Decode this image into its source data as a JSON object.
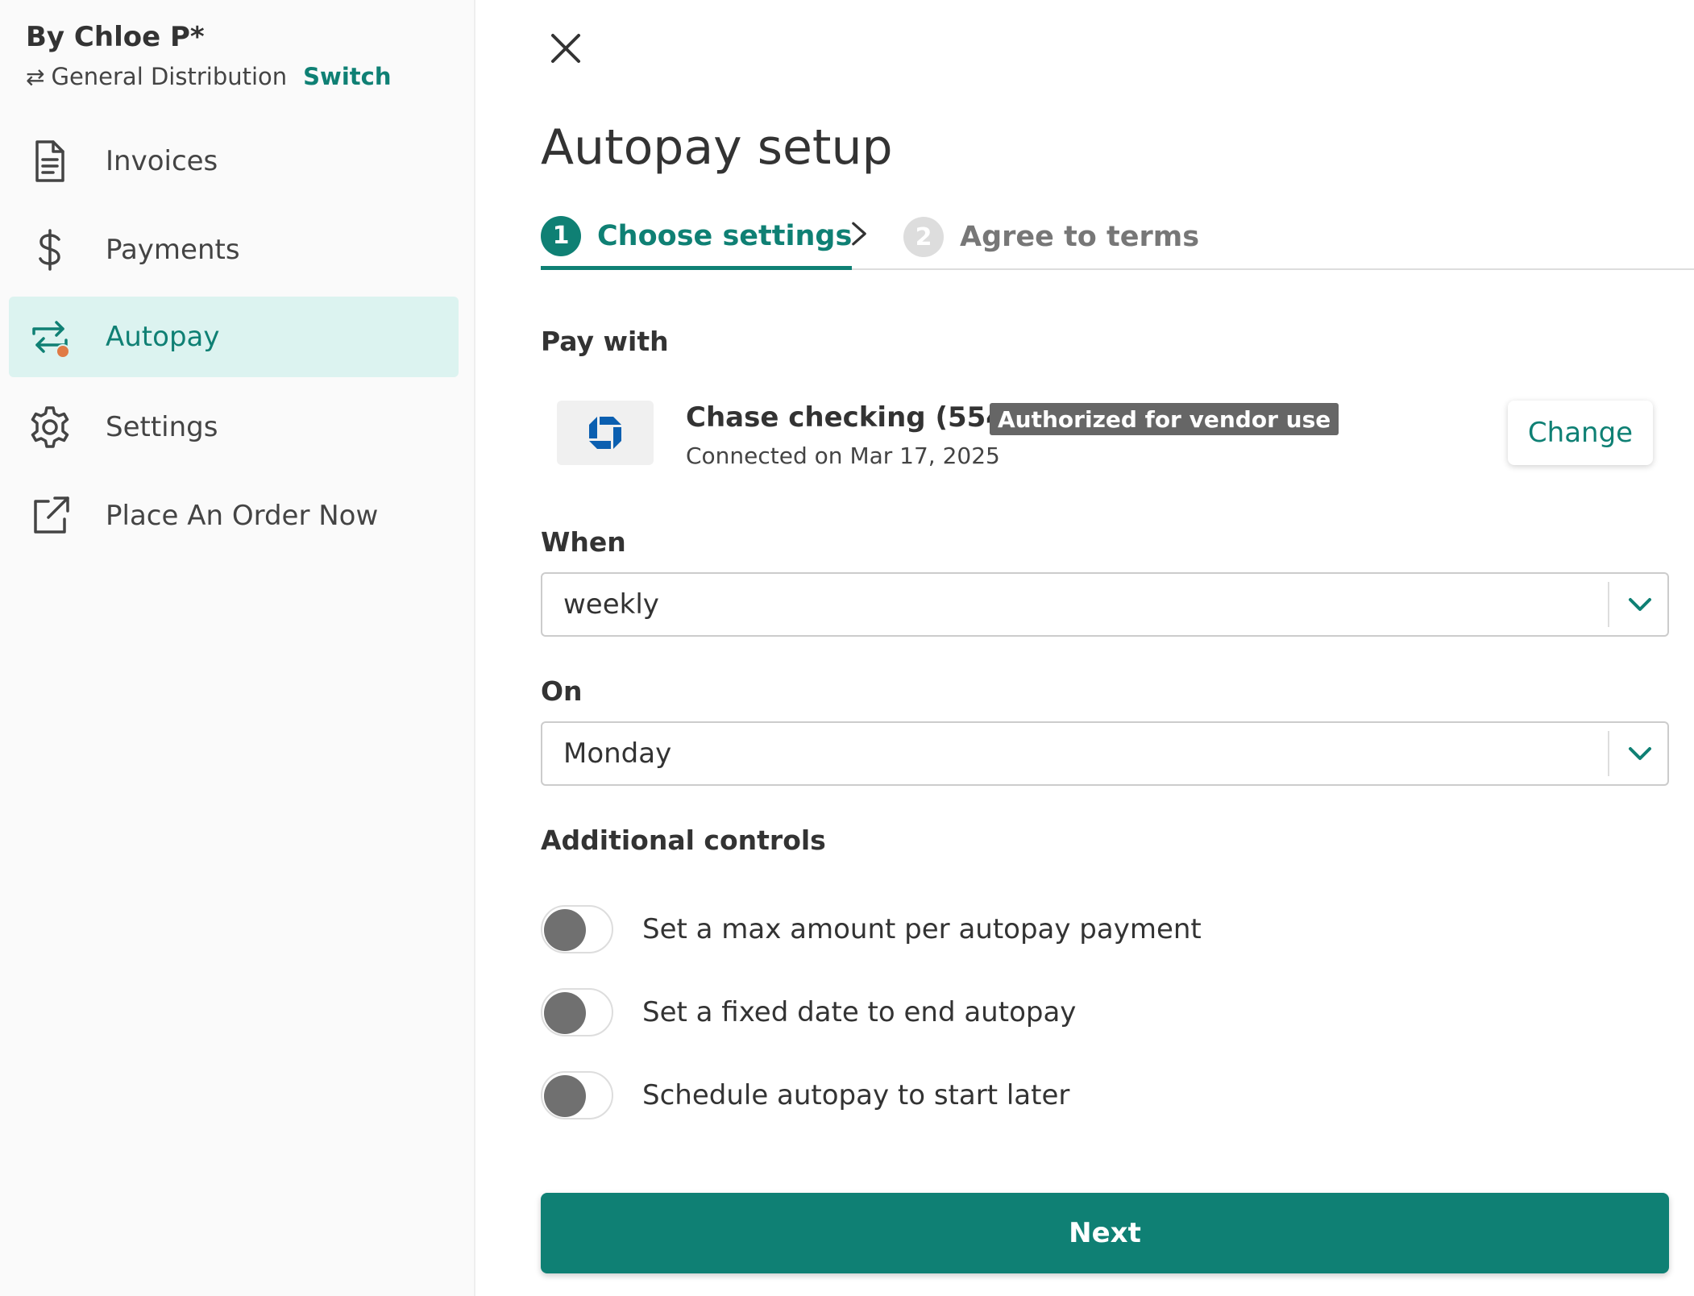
{
  "sidebar": {
    "brand_name": "By Chloe P*",
    "org_name": "General Distribution",
    "switch_label": "Switch",
    "items": [
      {
        "label": "Invoices",
        "icon": "document-icon"
      },
      {
        "label": "Payments",
        "icon": "dollar-icon"
      },
      {
        "label": "Autopay",
        "icon": "autopay-icon",
        "active": true
      },
      {
        "label": "Settings",
        "icon": "gear-icon"
      },
      {
        "label": "Place An Order Now",
        "icon": "external-link-icon"
      }
    ]
  },
  "main": {
    "title": "Autopay setup",
    "steps": [
      {
        "number": "1",
        "label": "Choose settings",
        "active": true
      },
      {
        "number": "2",
        "label": "Agree to terms",
        "active": false
      }
    ],
    "pay_with": {
      "label": "Pay with",
      "bank_name": "Chase checking (5544)",
      "badge": "Authorized for vendor use",
      "connected": "Connected on Mar 17, 2025",
      "change_label": "Change"
    },
    "when": {
      "label": "When",
      "value": "weekly"
    },
    "on": {
      "label": "On",
      "value": "Monday"
    },
    "additional_controls": {
      "label": "Additional controls",
      "toggles": [
        {
          "label": "Set a max amount per autopay payment",
          "on": false
        },
        {
          "label": "Set a fixed date to end autopay",
          "on": false
        },
        {
          "label": "Schedule autopay to start later",
          "on": false
        }
      ]
    },
    "next_label": "Next"
  },
  "colors": {
    "accent": "#0f8074",
    "active_bg": "#dcf3f0",
    "notification_dot": "#e07a45",
    "chase_blue": "#0b5fb0"
  }
}
